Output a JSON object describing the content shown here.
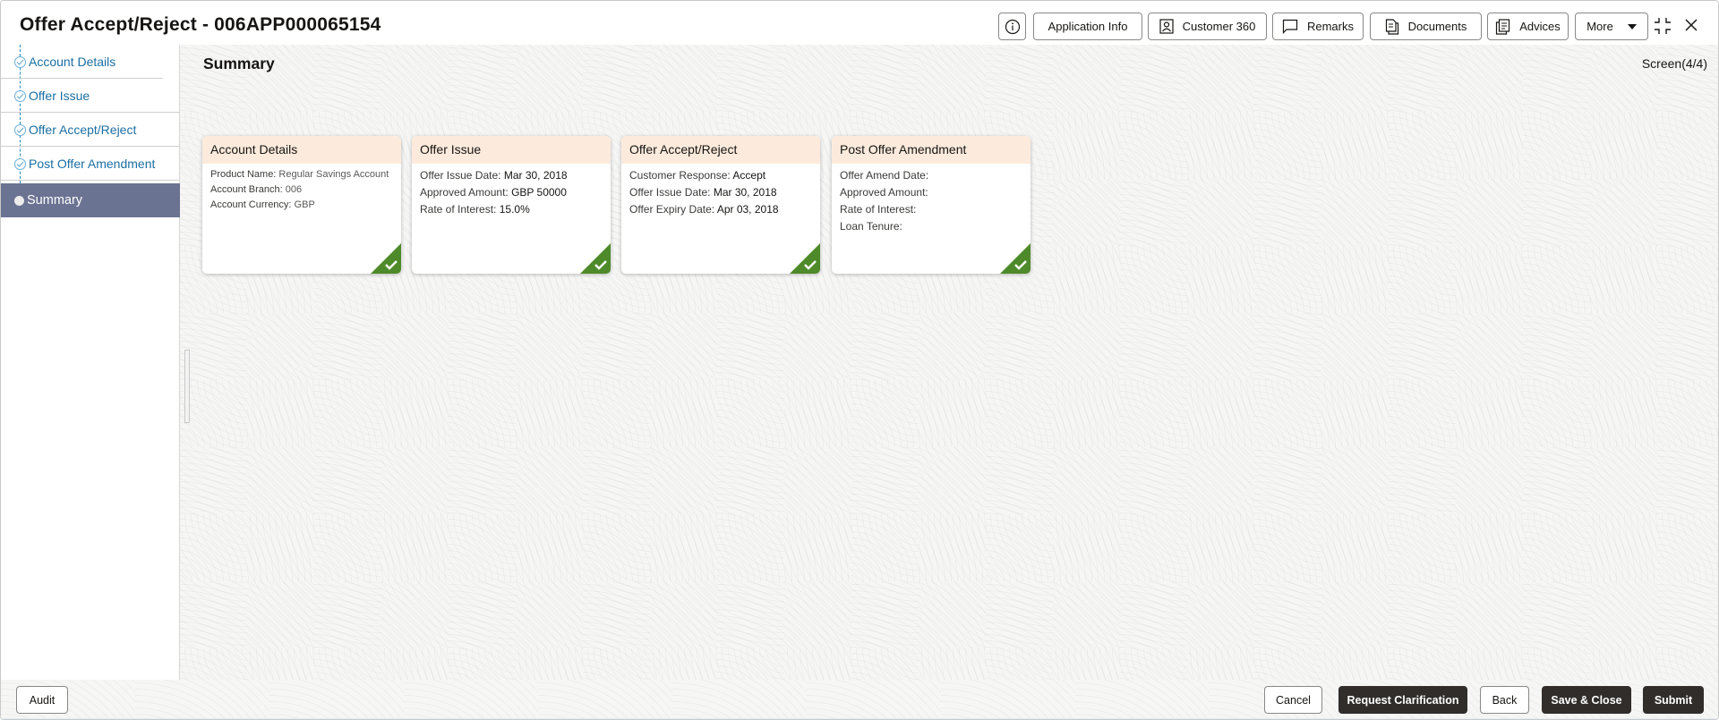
{
  "header": {
    "title": "Offer Accept/Reject - 006APP000065154",
    "buttons": {
      "info_icon": "info-icon",
      "application_info": "Application Info",
      "customer_360": "Customer 360",
      "remarks": "Remarks",
      "documents": "Documents",
      "advices": "Advices",
      "more": "More"
    }
  },
  "sidebar": {
    "items": [
      {
        "label": "Account Details",
        "status": "completed"
      },
      {
        "label": "Offer Issue",
        "status": "completed"
      },
      {
        "label": "Offer Accept/Reject",
        "status": "completed"
      },
      {
        "label": "Post Offer Amendment",
        "status": "completed"
      },
      {
        "label": "Summary",
        "status": "active"
      }
    ]
  },
  "main": {
    "title": "Summary",
    "screen_indicator": "Screen(4/4)",
    "cards": [
      {
        "title": "Account Details",
        "rows": [
          {
            "key": "Product Name: ",
            "value": "Regular Savings Account"
          },
          {
            "key": "Account Branch: ",
            "value": "006"
          },
          {
            "key": "Account Currency: ",
            "value": "GBP"
          }
        ],
        "status": "completed"
      },
      {
        "title": "Offer Issue",
        "rows": [
          {
            "key": "Offer Issue Date: ",
            "value": "Mar 30, 2018"
          },
          {
            "key": "Approved Amount: ",
            "value": "GBP 50000"
          },
          {
            "key": "Rate of Interest: ",
            "value": "15.0%"
          }
        ],
        "status": "completed"
      },
      {
        "title": "Offer Accept/Reject",
        "rows": [
          {
            "key": "Customer Response: ",
            "value": "Accept"
          },
          {
            "key": "Offer Issue Date: ",
            "value": "Mar 30, 2018"
          },
          {
            "key": "Offer Expiry Date: ",
            "value": "Apr 03, 2018"
          }
        ],
        "status": "completed"
      },
      {
        "title": "Post Offer Amendment",
        "rows": [
          {
            "key": "Offer Amend Date:",
            "value": ""
          },
          {
            "key": "Approved Amount:",
            "value": ""
          },
          {
            "key": "Rate of Interest:",
            "value": ""
          },
          {
            "key": "Loan Tenure:",
            "value": ""
          }
        ],
        "status": "completed"
      }
    ]
  },
  "footer": {
    "audit": "Audit",
    "cancel": "Cancel",
    "request_clarification": "Request Clarification",
    "back": "Back",
    "save_close": "Save & Close",
    "submit": "Submit"
  },
  "colors": {
    "sidebar_active": "#6b7393",
    "card_header": "#fcebdc",
    "check_green": "#4e8a2a",
    "primary_button": "#312d2a",
    "link_blue": "#1b6fa3"
  }
}
